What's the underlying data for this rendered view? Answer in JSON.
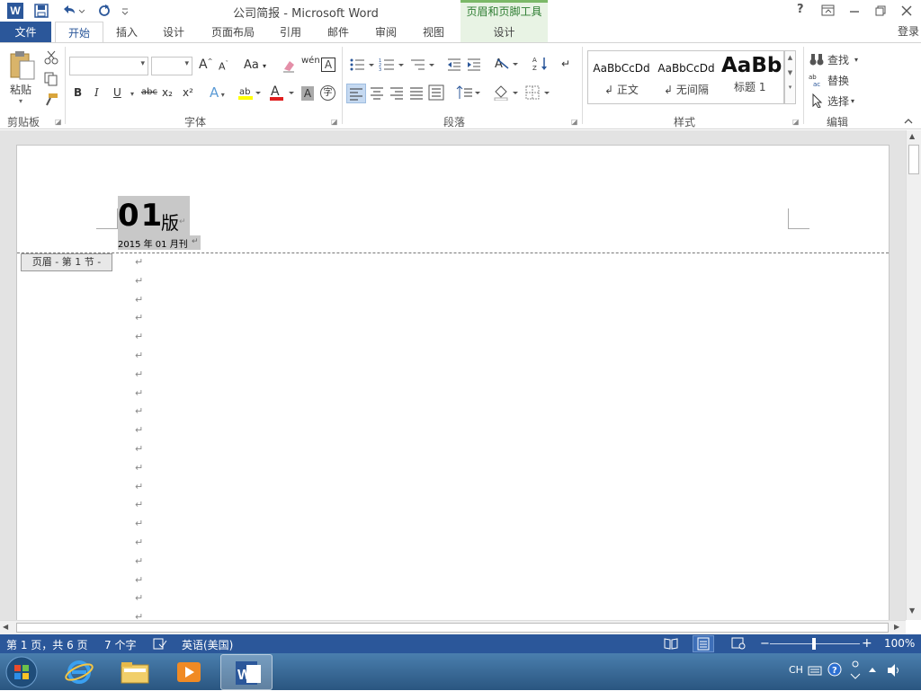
{
  "window": {
    "title": "公司简报 - Microsoft Word",
    "context_header": "页眉和页脚工具",
    "help": "?",
    "signin": "登录"
  },
  "tabs": {
    "file": "文件",
    "items": [
      "开始",
      "插入",
      "设计",
      "页面布局",
      "引用",
      "邮件",
      "审阅",
      "视图"
    ],
    "context_design": "设计"
  },
  "ribbon": {
    "clipboard": {
      "paste": "粘贴",
      "label": "剪贴板"
    },
    "font": {
      "label": "字体",
      "aa": "Aa",
      "bold": "B",
      "italic": "I",
      "underline": "U",
      "strike": "abc",
      "sub": "x₂",
      "sup": "x²",
      "phonetic": "wén",
      "grow": "A",
      "shrink": "A"
    },
    "paragraph": {
      "label": "段落"
    },
    "styles": {
      "label": "样式",
      "items": [
        {
          "preview": "AaBbCcDd",
          "name": "正文"
        },
        {
          "preview": "AaBbCcDd",
          "name": "无间隔"
        },
        {
          "preview": "AaBb",
          "name": "标题 1"
        }
      ]
    },
    "editing": {
      "label": "编辑",
      "find": "查找",
      "replace": "替换",
      "select": "选择"
    }
  },
  "document": {
    "header_big": "01",
    "header_ban": "版",
    "header_date": "2015 年 01 月刊",
    "header_tag": "页眉 - 第 1 节 -",
    "para_mark": "↵",
    "para_count": 20
  },
  "status": {
    "page": "第 1 页，共 6 页",
    "words": "7 个字",
    "language": "英语(美国)",
    "zoom": "100%"
  },
  "tray": {
    "lang": "CH"
  }
}
